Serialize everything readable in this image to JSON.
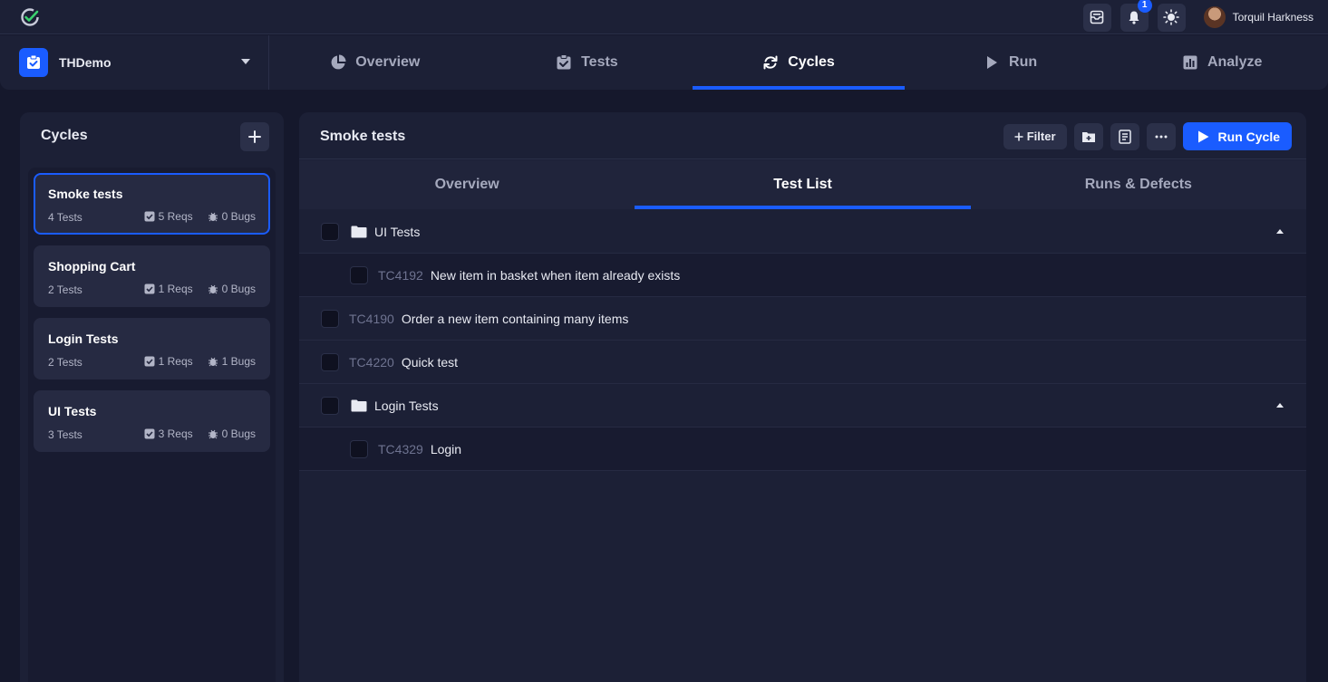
{
  "topbar": {
    "notification_count": "1",
    "user_name": "Torquil Harkness"
  },
  "project": {
    "name": "THDemo"
  },
  "nav": {
    "tabs": [
      {
        "label": "Overview",
        "icon": "pie-chart-icon"
      },
      {
        "label": "Tests",
        "icon": "checkbox-icon"
      },
      {
        "label": "Cycles",
        "icon": "refresh-icon",
        "active": true
      },
      {
        "label": "Run",
        "icon": "play-icon"
      },
      {
        "label": "Analyze",
        "icon": "bar-chart-icon"
      }
    ]
  },
  "sidebar": {
    "title": "Cycles",
    "cycles": [
      {
        "name": "Smoke tests",
        "tests": "4 Tests",
        "reqs": "5 Reqs",
        "bugs": "0 Bugs",
        "selected": true
      },
      {
        "name": "Shopping Cart",
        "tests": "2 Tests",
        "reqs": "1 Reqs",
        "bugs": "0 Bugs"
      },
      {
        "name": "Login Tests",
        "tests": "2 Tests",
        "reqs": "1 Reqs",
        "bugs": "1 Bugs"
      },
      {
        "name": "UI Tests",
        "tests": "3 Tests",
        "reqs": "3 Reqs",
        "bugs": "0 Bugs"
      }
    ]
  },
  "main": {
    "title": "Smoke tests",
    "filter_label": "Filter",
    "run_label": "Run Cycle",
    "tabs": [
      {
        "label": "Overview"
      },
      {
        "label": "Test List",
        "active": true
      },
      {
        "label": "Runs & Defects"
      }
    ],
    "rows": [
      {
        "type": "folder",
        "label": "UI Tests"
      },
      {
        "type": "child",
        "id": "TC4192",
        "name": "New item in basket when item already exists"
      },
      {
        "type": "test",
        "id": "TC4190",
        "name": "Order a new item containing many items"
      },
      {
        "type": "test",
        "id": "TC4220",
        "name": "Quick test"
      },
      {
        "type": "folder",
        "label": "Login Tests"
      },
      {
        "type": "child",
        "id": "TC4329",
        "name": "Login"
      }
    ]
  },
  "colors": {
    "accent": "#1a5cff",
    "background": "#15182c",
    "panel": "#1c2036"
  }
}
